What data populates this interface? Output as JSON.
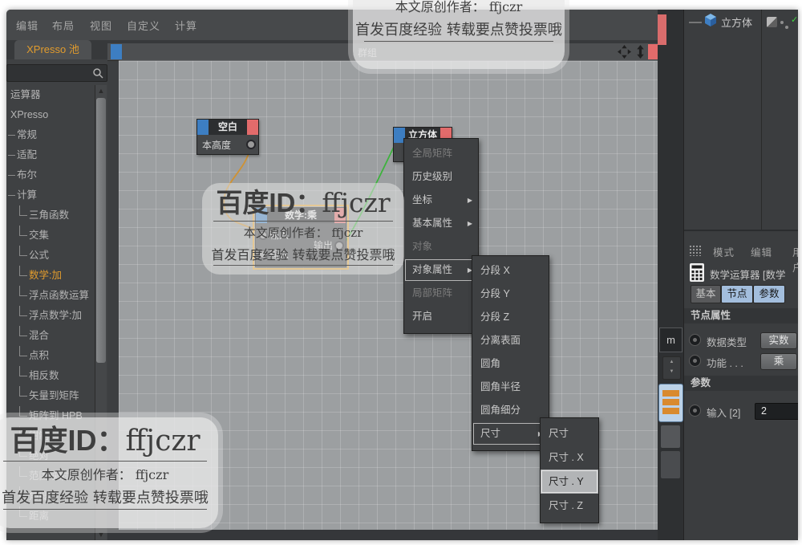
{
  "menubar": {
    "items": [
      "编辑",
      "布局",
      "视图",
      "自定义",
      "计算"
    ]
  },
  "pool": {
    "tab": "XPresso 池",
    "items": [
      {
        "label": "运算器"
      },
      {
        "label": "XPresso"
      },
      {
        "label": "常规"
      },
      {
        "label": "适配"
      },
      {
        "label": "布尔"
      },
      {
        "label": "计算"
      },
      {
        "label": "三角函数"
      },
      {
        "label": "交集"
      },
      {
        "label": "公式"
      },
      {
        "label": "数学:加",
        "active": true
      },
      {
        "label": "浮点函数运算"
      },
      {
        "label": "浮点数学:加"
      },
      {
        "label": "混合"
      },
      {
        "label": "点积"
      },
      {
        "label": "相反数"
      },
      {
        "label": "矢量到矩阵"
      },
      {
        "label": "矩阵到 HPB"
      },
      {
        "label": "钳制"
      },
      {
        "label": "绝对"
      },
      {
        "label": "范围映射"
      },
      {
        "label": "角度"
      },
      {
        "label": "距离"
      }
    ]
  },
  "editor": {
    "title": "群组"
  },
  "nodes": {
    "blank": {
      "title": "空白",
      "port": "本高度"
    },
    "math": {
      "title": "数学:乘",
      "input1": "输入",
      "input2": "输入",
      "output": "输出"
    },
    "cube": {
      "title": "立方体"
    }
  },
  "node_menu": {
    "items": [
      {
        "label": "全局矩阵",
        "disabled": true
      },
      {
        "label": "历史级别"
      },
      {
        "label": "坐标",
        "submenu": true
      },
      {
        "label": "基本属性",
        "submenu": true
      },
      {
        "label": "对象",
        "disabled": true
      },
      {
        "label": "对象属性",
        "submenu": true,
        "highlighted": true
      },
      {
        "label": "局部矩阵",
        "disabled": true
      },
      {
        "label": "开启"
      }
    ]
  },
  "object_attr_menu": {
    "items": [
      {
        "label": "分段 X"
      },
      {
        "label": "分段 Y"
      },
      {
        "label": "分段 Z"
      },
      {
        "label": "分离表面"
      },
      {
        "label": "圆角"
      },
      {
        "label": "圆角半径"
      },
      {
        "label": "圆角细分"
      },
      {
        "label": "尺寸",
        "submenu": true,
        "highlighted": true
      }
    ]
  },
  "size_menu": {
    "items": [
      {
        "label": "尺寸"
      },
      {
        "label": "尺寸 . X"
      },
      {
        "label": "尺寸 . Y",
        "selected": true
      },
      {
        "label": "尺寸 . Z"
      }
    ]
  },
  "object_manager": {
    "object_name": "立方体"
  },
  "attr_panel": {
    "menu_mode": "模式",
    "menu_edit": "编辑",
    "menu_user": "用户",
    "title": "数学运算器 [数学",
    "tab_basic": "基本",
    "tab_node": "节点",
    "tab_param": "参数",
    "node_section": "节点属性",
    "data_type_label": "数据类型",
    "data_type_value": "实数",
    "function_label": "功能 . . .",
    "function_value": "乘",
    "param_section": "参数",
    "input_label": "输入 [2]",
    "input_value": "2"
  },
  "side_strip": {
    "unit": "m"
  },
  "watermark": {
    "big_prefix": "百度ID：",
    "big_id": "ffjczr",
    "line1": "本文原创作者：  ffjczr",
    "line2": "首发百度经验 转载要点赞投票哦"
  },
  "colors": {
    "accent_orange": "#e09b2d",
    "node_blue": "#3d7ec2",
    "node_red": "#e26b6b",
    "wire_orange": "#cf9232",
    "wire_green": "#3db33d",
    "tab_blue": "#a3bedd"
  }
}
